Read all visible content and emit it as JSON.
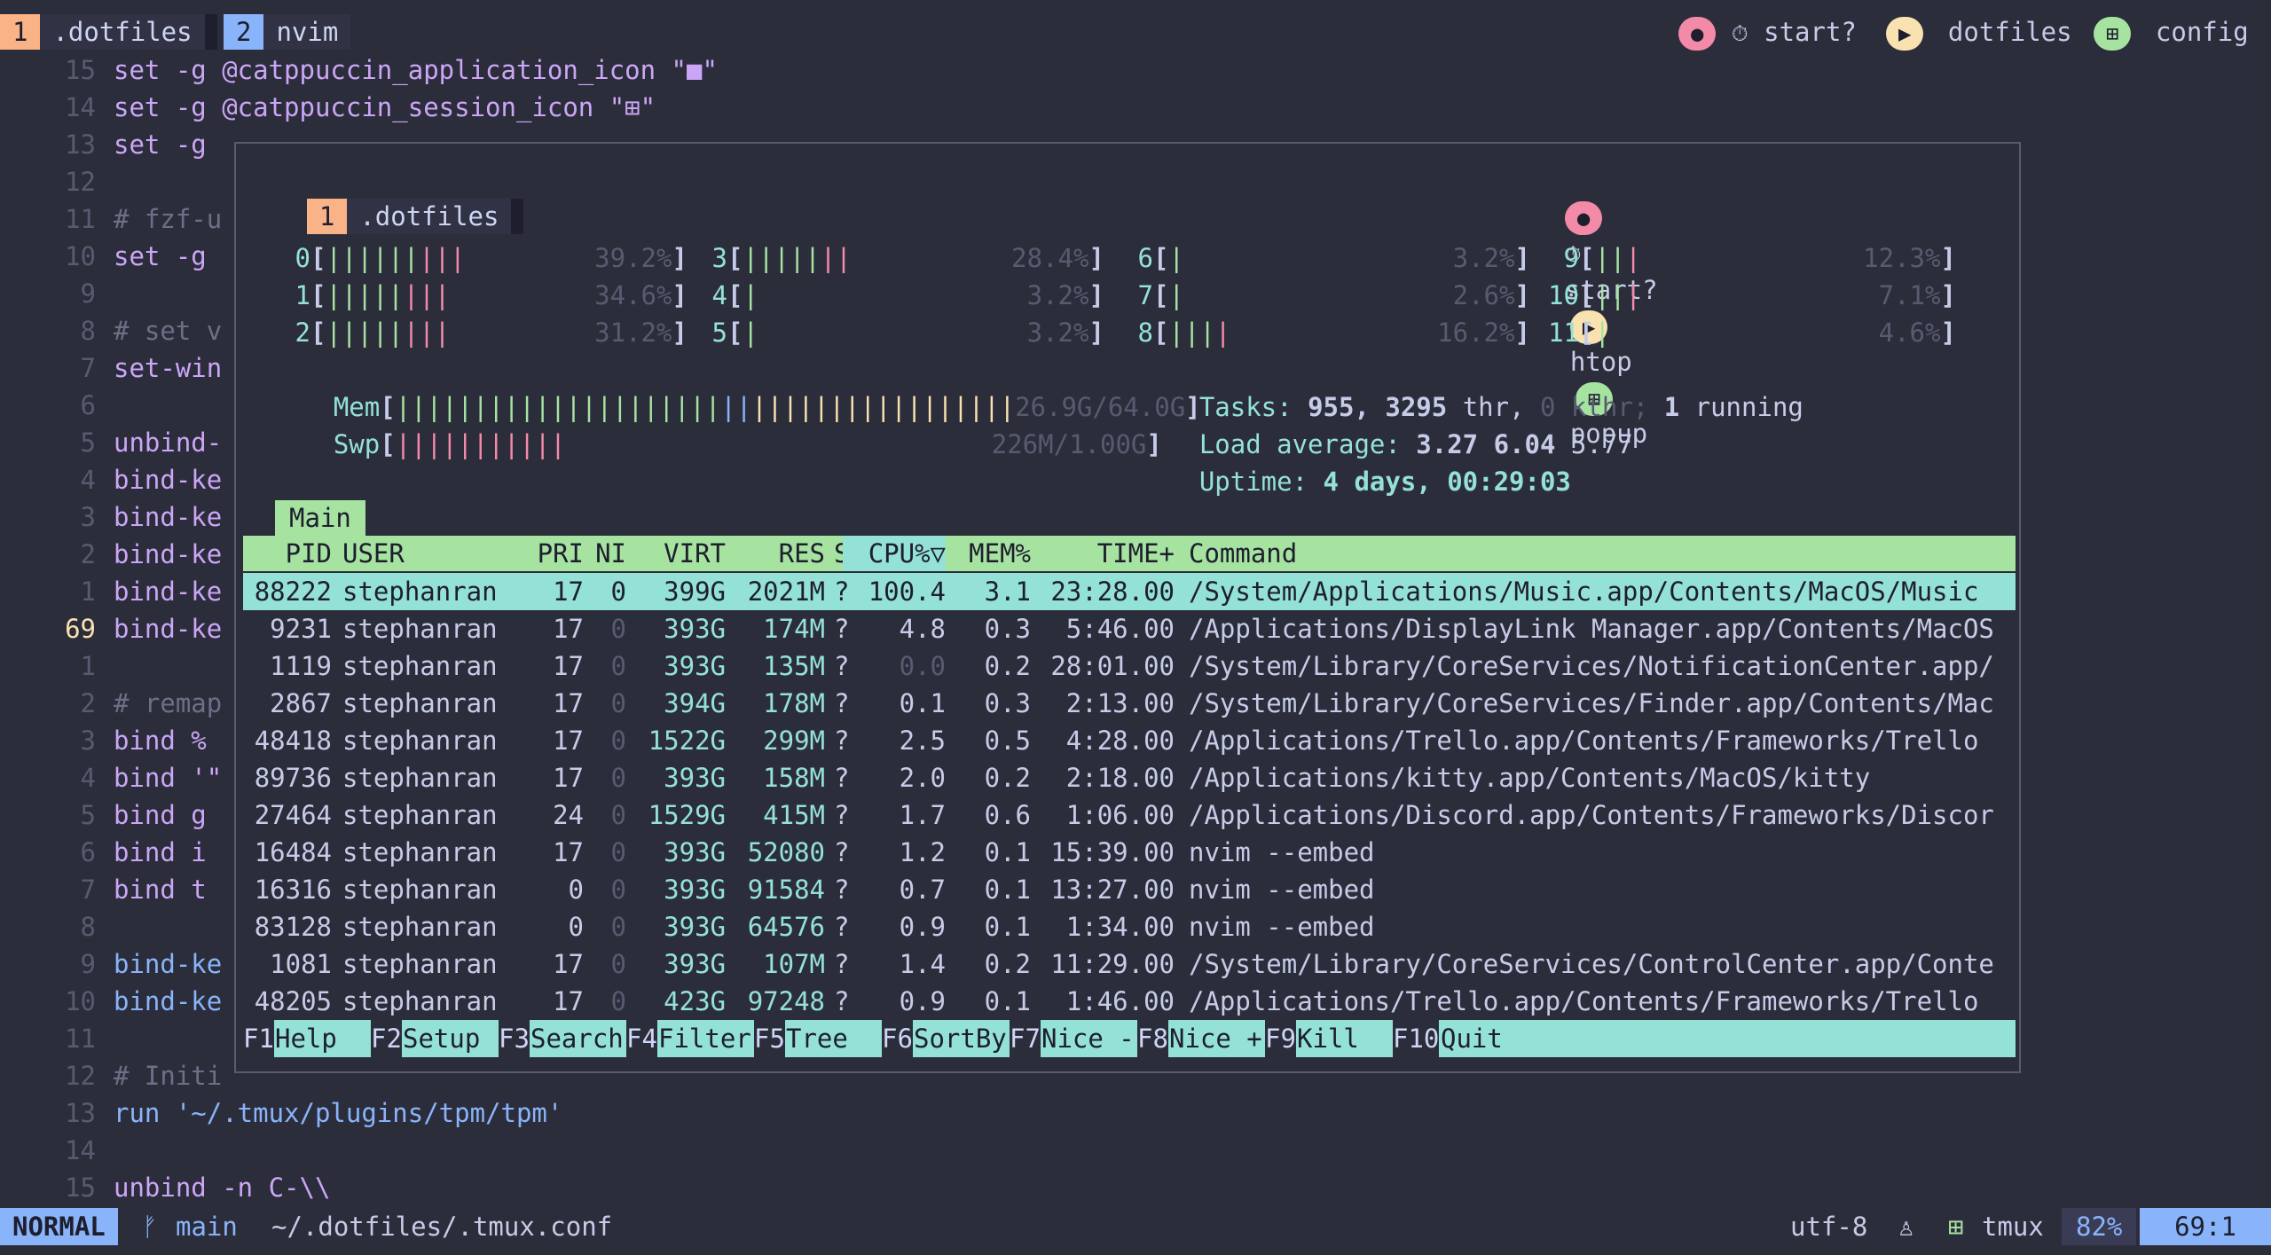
{
  "tmux": {
    "windows": [
      {
        "num": "1",
        "name": ".dotfiles"
      },
      {
        "num": "2",
        "name": "nvim"
      }
    ],
    "right": {
      "status1": "start?",
      "session": "dotfiles",
      "config": "config"
    }
  },
  "editor": {
    "lines": [
      {
        "n": "15",
        "text": "set -g @catppuccin_application_icon \"■\""
      },
      {
        "n": "14",
        "text": "set -g @catppuccin_session_icon \"⊞\""
      },
      {
        "n": "13",
        "text": "set -g"
      },
      {
        "n": "12",
        "text": ""
      },
      {
        "n": "11",
        "text": "# fzf-u"
      },
      {
        "n": "10",
        "text": "set -g"
      },
      {
        "n": "9",
        "text": ""
      },
      {
        "n": "8",
        "text": "# set v"
      },
      {
        "n": "7",
        "text": "set-win"
      },
      {
        "n": "6",
        "text": ""
      },
      {
        "n": "5",
        "text": "unbind-"
      },
      {
        "n": "4",
        "text": "bind-ke"
      },
      {
        "n": "3",
        "text": "bind-ke"
      },
      {
        "n": "2",
        "text": "bind-ke"
      },
      {
        "n": "1",
        "text": "bind-ke"
      },
      {
        "n": "69",
        "text": "bind-ke"
      },
      {
        "n": "1",
        "text": ""
      },
      {
        "n": "2",
        "text": "# remap"
      },
      {
        "n": "3",
        "text": "bind %"
      },
      {
        "n": "4",
        "text": "bind '\""
      },
      {
        "n": "5",
        "text": "bind g"
      },
      {
        "n": "6",
        "text": "bind i"
      },
      {
        "n": "7",
        "text": "bind t"
      },
      {
        "n": "8",
        "text": ""
      },
      {
        "n": "9",
        "text": "bind-ke"
      },
      {
        "n": "10",
        "text": "bind-ke"
      },
      {
        "n": "11",
        "text": ""
      },
      {
        "n": "12",
        "text": "# Initi"
      },
      {
        "n": "13",
        "text": "run '~/.tmux/plugins/tpm/tpm'"
      },
      {
        "n": "14",
        "text": ""
      },
      {
        "n": "15",
        "text": "unbind -n C-\\\\"
      }
    ]
  },
  "popup": {
    "window": {
      "num": "1",
      "name": ".dotfiles"
    },
    "right": {
      "status1": "start?",
      "app": "htop",
      "session": "popup"
    },
    "cpus": [
      {
        "id": "0",
        "bars": "|||||||||",
        "pct": "39.2%"
      },
      {
        "id": "1",
        "bars": "||||||||",
        "pct": "34.6%"
      },
      {
        "id": "2",
        "bars": "||||||||",
        "pct": "31.2%"
      },
      {
        "id": "3",
        "bars": "|||||||",
        "pct": "28.4%"
      },
      {
        "id": "4",
        "bars": "|",
        "pct": "3.2%"
      },
      {
        "id": "5",
        "bars": "|",
        "pct": "3.2%"
      },
      {
        "id": "6",
        "bars": "|",
        "pct": "3.2%"
      },
      {
        "id": "7",
        "bars": "|",
        "pct": "2.6%"
      },
      {
        "id": "8",
        "bars": "||||",
        "pct": "16.2%"
      },
      {
        "id": "9",
        "bars": "|||",
        "pct": "12.3%"
      },
      {
        "id": "10",
        "bars": "|||",
        "pct": "7.1%"
      },
      {
        "id": "11",
        "bars": "|",
        "pct": "4.6%"
      }
    ],
    "mem": {
      "label": "Mem",
      "value": "26.9G/64.0G"
    },
    "swp": {
      "label": "Swp",
      "value": "226M/1.00G"
    },
    "tasks": {
      "label": "Tasks:",
      "count": "955,",
      "thr": "3295",
      "thr_label": "thr,",
      "kthr": "0 kthr;",
      "running": "1",
      "running_label": "running"
    },
    "load": {
      "label": "Load average:",
      "l1": "3.27",
      "l5": "6.04",
      "l15": "5.77"
    },
    "uptime": {
      "label": "Uptime:",
      "value": "4 days, 00:29:03"
    },
    "tab": "Main",
    "headers": [
      "PID",
      "USER",
      "PRI",
      "NI",
      "VIRT",
      "RES",
      "S",
      "CPU%▽",
      "MEM%",
      "TIME+",
      "Command"
    ],
    "processes": [
      {
        "pid": "88222",
        "user": "stephanran",
        "pri": "17",
        "ni": "0",
        "virt": "399G",
        "res": "2021M",
        "s": "?",
        "cpu": "100.4",
        "mem": "3.1",
        "time": "23:28.00",
        "cmd": "/System/Applications/Music.app/Contents/MacOS/Music"
      },
      {
        "pid": "9231",
        "user": "stephanran",
        "pri": "17",
        "ni": "0",
        "virt": "393G",
        "res": "174M",
        "s": "?",
        "cpu": "4.8",
        "mem": "0.3",
        "time": "5:46.00",
        "cmd": "/Applications/DisplayLink Manager.app/Contents/MacOS"
      },
      {
        "pid": "1119",
        "user": "stephanran",
        "pri": "17",
        "ni": "0",
        "virt": "393G",
        "res": "135M",
        "s": "?",
        "cpu": "0.0",
        "mem": "0.2",
        "time": "28:01.00",
        "cmd": "/System/Library/CoreServices/NotificationCenter.app/"
      },
      {
        "pid": "2867",
        "user": "stephanran",
        "pri": "17",
        "ni": "0",
        "virt": "394G",
        "res": "178M",
        "s": "?",
        "cpu": "0.1",
        "mem": "0.3",
        "time": "2:13.00",
        "cmd": "/System/Library/CoreServices/Finder.app/Contents/Mac"
      },
      {
        "pid": "48418",
        "user": "stephanran",
        "pri": "17",
        "ni": "0",
        "virt": "1522G",
        "res": "299M",
        "s": "?",
        "cpu": "2.5",
        "mem": "0.5",
        "time": "4:28.00",
        "cmd": "/Applications/Trello.app/Contents/Frameworks/Trello"
      },
      {
        "pid": "89736",
        "user": "stephanran",
        "pri": "17",
        "ni": "0",
        "virt": "393G",
        "res": "158M",
        "s": "?",
        "cpu": "2.0",
        "mem": "0.2",
        "time": "2:18.00",
        "cmd": "/Applications/kitty.app/Contents/MacOS/kitty"
      },
      {
        "pid": "27464",
        "user": "stephanran",
        "pri": "24",
        "ni": "0",
        "virt": "1529G",
        "res": "415M",
        "s": "?",
        "cpu": "1.7",
        "mem": "0.6",
        "time": "1:06.00",
        "cmd": "/Applications/Discord.app/Contents/Frameworks/Discor"
      },
      {
        "pid": "16484",
        "user": "stephanran",
        "pri": "17",
        "ni": "0",
        "virt": "393G",
        "res": "52080",
        "s": "?",
        "cpu": "1.2",
        "mem": "0.1",
        "time": "15:39.00",
        "cmd": "nvim --embed"
      },
      {
        "pid": "16316",
        "user": "stephanran",
        "pri": "0",
        "ni": "0",
        "virt": "393G",
        "res": "91584",
        "s": "?",
        "cpu": "0.7",
        "mem": "0.1",
        "time": "13:27.00",
        "cmd": "nvim --embed"
      },
      {
        "pid": "83128",
        "user": "stephanran",
        "pri": "0",
        "ni": "0",
        "virt": "393G",
        "res": "64576",
        "s": "?",
        "cpu": "0.9",
        "mem": "0.1",
        "time": "1:34.00",
        "cmd": "nvim --embed"
      },
      {
        "pid": "1081",
        "user": "stephanran",
        "pri": "17",
        "ni": "0",
        "virt": "393G",
        "res": "107M",
        "s": "?",
        "cpu": "1.4",
        "mem": "0.2",
        "time": "11:29.00",
        "cmd": "/System/Library/CoreServices/ControlCenter.app/Conte"
      },
      {
        "pid": "48205",
        "user": "stephanran",
        "pri": "17",
        "ni": "0",
        "virt": "423G",
        "res": "97248",
        "s": "?",
        "cpu": "0.9",
        "mem": "0.1",
        "time": "1:46.00",
        "cmd": "/Applications/Trello.app/Contents/Frameworks/Trello"
      }
    ],
    "fkeys": [
      {
        "key": "F1",
        "label": "Help"
      },
      {
        "key": "F2",
        "label": "Setup"
      },
      {
        "key": "F3",
        "label": "Search"
      },
      {
        "key": "F4",
        "label": "Filter"
      },
      {
        "key": "F5",
        "label": "Tree"
      },
      {
        "key": "F6",
        "label": "SortBy"
      },
      {
        "key": "F7",
        "label": "Nice -"
      },
      {
        "key": "F8",
        "label": "Nice +"
      },
      {
        "key": "F9",
        "label": "Kill"
      },
      {
        "key": "F10",
        "label": "Quit"
      }
    ]
  },
  "statusline": {
    "mode": "NORMAL",
    "branch": "main",
    "file": "~/.dotfiles/.tmux.conf",
    "encoding": "utf-8",
    "filetype": "tmux",
    "percent": "82%",
    "position": "69:1"
  },
  "colors": {
    "bg": "#2c2d3b",
    "peach": "#fab387",
    "blue": "#89b4fa",
    "pink": "#f38ba8",
    "yellow": "#f9e2af",
    "green": "#a6e3a1",
    "teal": "#94e2d5"
  }
}
